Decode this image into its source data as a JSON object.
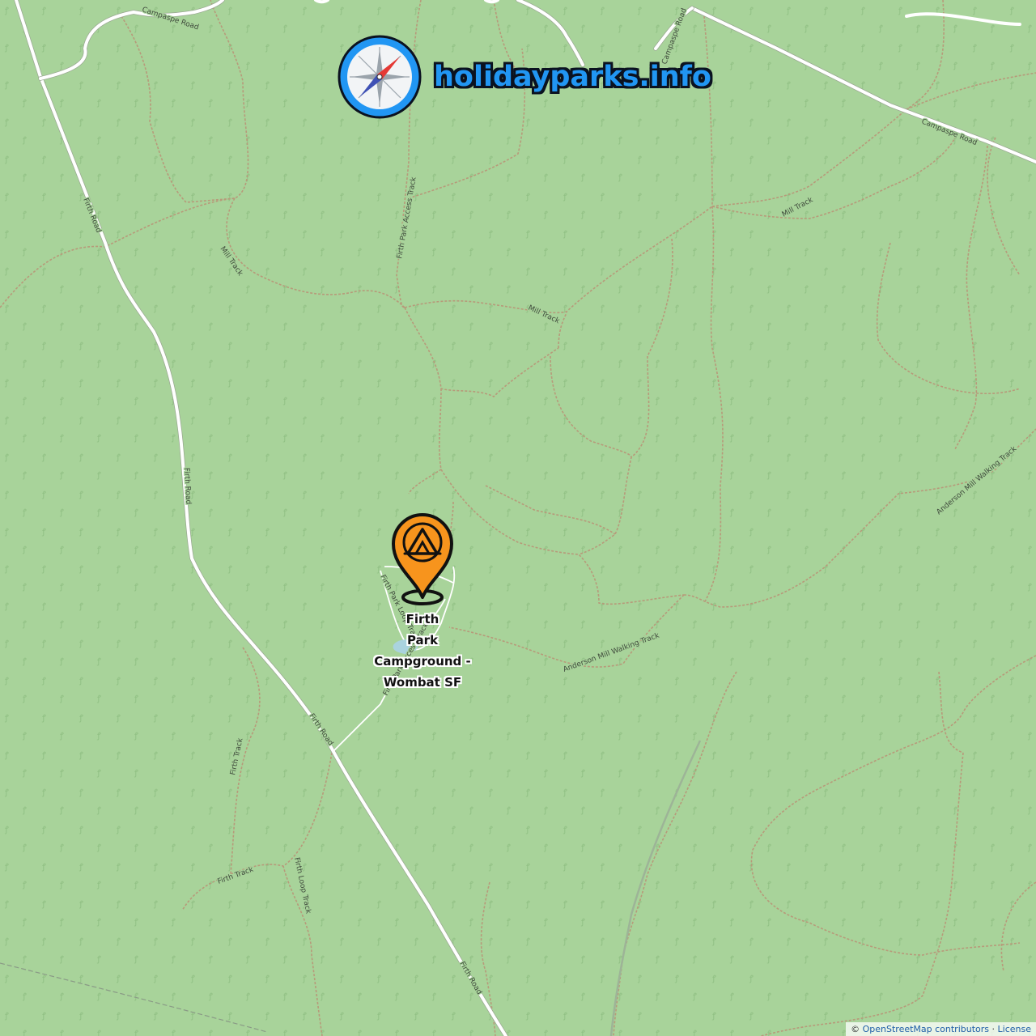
{
  "brand": {
    "title": "holidayparks.info",
    "logo_icon": "compass-icon",
    "accent_color": "#2196f3"
  },
  "map": {
    "background_color": "#a8d39a",
    "road_labels": {
      "campaspe_nw": "Campaspe Road",
      "campaspe_n": "Campaspe Road",
      "campaspe_ne": "Campaspe Road",
      "firth_road_1": "Firth Road",
      "firth_road_2": "Firth Road",
      "firth_road_3": "Firth Road",
      "firth_road_4": "Firth Road",
      "mill_track_1": "Mill Track",
      "mill_track_2": "Mill Track",
      "mill_track_3": "Mill Track",
      "firth_park_access_1": "Firth Park Access Track",
      "firth_park_access_2": "Firth Park Access Track",
      "firth_park_loop": "Firth Park Loop Track",
      "anderson_mill_1": "Anderson Mill Walking Track",
      "anderson_mill_2": "Anderson Mill Walking Track",
      "firth_track_1": "Firth Track",
      "firth_track_2": "Firth Track",
      "firth_loop_track": "Firth Loop Track"
    }
  },
  "poi": {
    "name": "Firth Park Campground - Wombat SF",
    "name_lines": [
      "Firth",
      "Park",
      "Campground -",
      "Wombat SF"
    ],
    "marker_icon": "tent-marker-icon",
    "marker_color": "#f7941d"
  },
  "attribution": {
    "copyright": "©",
    "osm_link": "OpenStreetMap contributors",
    "separator": "·",
    "license_link": "License"
  }
}
